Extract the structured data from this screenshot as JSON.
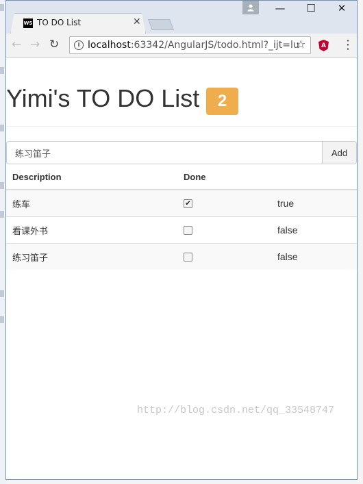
{
  "browser": {
    "tab_title": "TO DO List",
    "tab_favicon_label": "WS",
    "url_host": "localhost",
    "url_rest": ":63342/AngularJS/todo.html?_ijt=lu",
    "icons": {
      "tab_close": "close-icon",
      "back": "back-arrow-icon",
      "forward": "forward-arrow-icon",
      "reload": "reload-icon",
      "site_info": "info-icon",
      "bookmark": "star-icon",
      "extension": "angular-extension-icon",
      "menu": "menu-dots-icon",
      "profile": "person-icon",
      "minimize": "minimize-icon",
      "maximize": "maximize-icon",
      "close": "window-close-icon"
    }
  },
  "app": {
    "title": "Yimi's TO DO List",
    "incomplete_count": "2",
    "badge_color": "#f0ad4e",
    "input_value": "练习笛子",
    "add_label": "Add",
    "table": {
      "headers": [
        "Description",
        "Done"
      ],
      "rows": [
        {
          "description": "练车",
          "done": true,
          "done_text": "true"
        },
        {
          "description": "看课外书",
          "done": false,
          "done_text": "false"
        },
        {
          "description": "练习笛子",
          "done": false,
          "done_text": "false"
        }
      ]
    }
  },
  "watermark": "http://blog.csdn.net/qq_33548747"
}
